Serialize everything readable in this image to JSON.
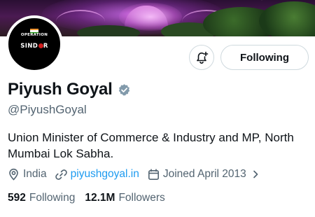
{
  "profile": {
    "avatar_top_text": "OPERATION",
    "avatar_main_text": "SIND",
    "avatar_main_text_end": "R",
    "display_name": "Piyush Goyal",
    "handle": "@PiyushGoyal",
    "bio": "Union Minister of Commerce & Industry and MP, North Mumbai Lok Sabha.",
    "location": "India",
    "website": "piyushgoyal.in",
    "joined": "Joined April 2013",
    "following_count": "592",
    "following_label": "Following",
    "followers_count": "12.1M",
    "followers_label": "Followers"
  },
  "actions": {
    "follow_button_label": "Following",
    "notify_icon": "bell-plus-icon"
  },
  "icons": {
    "verified": "verified-badge-icon",
    "location": "location-pin-icon",
    "link": "link-icon",
    "calendar": "calendar-icon",
    "chevron": "chevron-right-icon"
  },
  "colors": {
    "accent": "#1d9bf0",
    "text_primary": "#0f1419",
    "text_secondary": "#536471",
    "verified_badge": "#829aab",
    "border": "#cfd9de"
  }
}
